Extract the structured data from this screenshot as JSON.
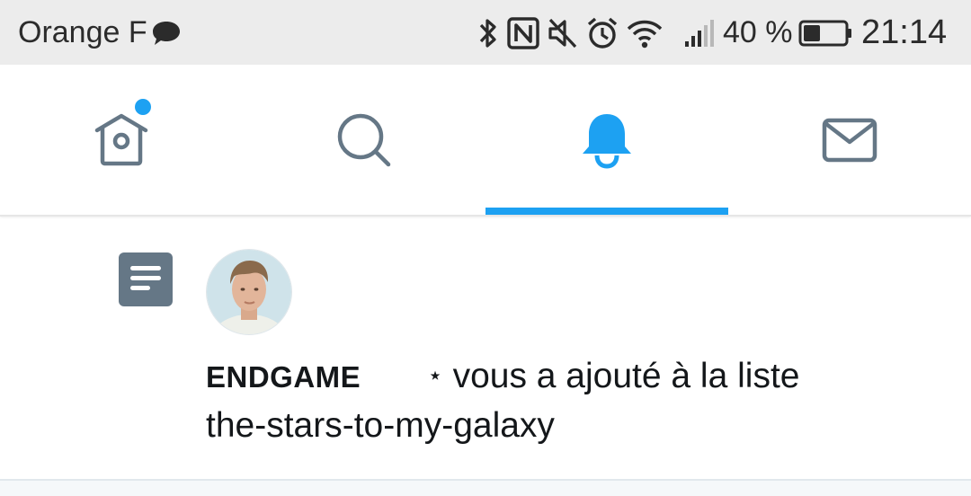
{
  "status_bar": {
    "carrier": "Orange F",
    "battery_percent": "40 %",
    "time": "21:14",
    "icons": [
      "chat-bubble-icon",
      "bluetooth-icon",
      "nfc-icon",
      "mute-icon",
      "alarm-icon",
      "wifi-icon",
      "signal-icon",
      "battery-icon"
    ]
  },
  "tabs": [
    {
      "name": "home",
      "icon": "home-icon",
      "has_notification_dot": true,
      "active": false
    },
    {
      "name": "search",
      "icon": "search-icon",
      "active": false
    },
    {
      "name": "notifications",
      "icon": "bell-icon",
      "active": true
    },
    {
      "name": "messages",
      "icon": "envelope-icon",
      "active": false
    }
  ],
  "notification": {
    "type_icon": "list-icon",
    "user": "ENDGAME",
    "star": "⋆",
    "action": "vous a ajouté à la liste",
    "list_name": "the-stars-to-my-galaxy"
  },
  "colors": {
    "accent": "#1da1f2",
    "icon_gray": "#657786",
    "text": "#14171a",
    "status_bar_bg": "#ececec"
  }
}
